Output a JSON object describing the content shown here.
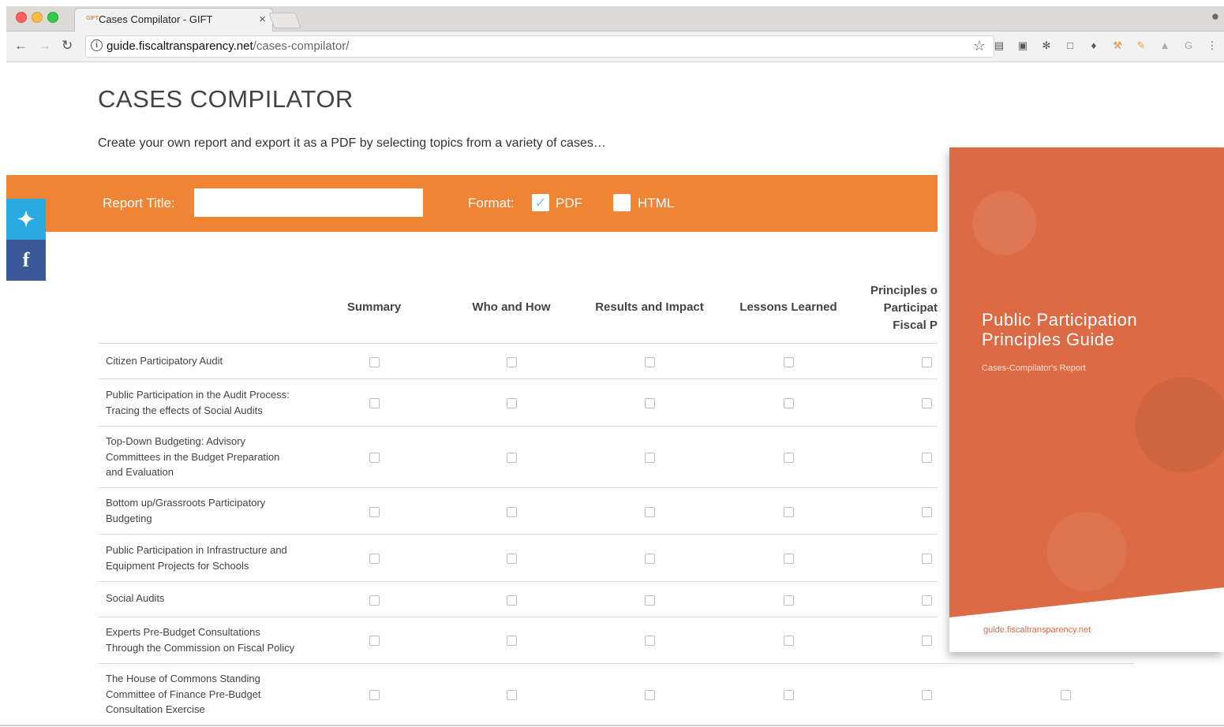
{
  "browser": {
    "tab_title": "Cases Compilator - GIFT",
    "tab_favicon": "GIFT",
    "tab_close": "×",
    "url_domain": "guide.fiscaltransparency.net",
    "url_path": "/cases-compilator/"
  },
  "page": {
    "title": "CASES COMPILATOR",
    "subtitle": "Create your own report and export it as a PDF by selecting topics from a variety of cases…"
  },
  "form": {
    "report_title_label": "Report Title:",
    "report_title_value": "",
    "format_label": "Format:",
    "formats": [
      {
        "label": "PDF",
        "checked": true
      },
      {
        "label": "HTML",
        "checked": false
      }
    ]
  },
  "social": {
    "twitter": "twitter-icon",
    "facebook": "facebook-icon"
  },
  "table": {
    "columns": [
      "Summary",
      "Who and How",
      "Results and Impact",
      "Lessons Learned",
      "Principles o\nParticipat\nFiscal P"
    ],
    "rows": [
      "Citizen Participatory Audit",
      "Public Participation in the Audit Process: Tracing the effects of Social Audits",
      "Top-Down Budgeting: Advisory Committees in the Budget Preparation and Evaluation",
      "Bottom up/Grassroots Participatory Budgeting",
      "Public Participation in Infrastructure and Equipment Projects for Schools",
      "Social Audits",
      "Experts Pre-Budget Consultations Through the Commission on Fiscal Policy",
      "The House of Commons Standing Committee of Finance Pre-Budget Consultation Exercise"
    ]
  },
  "cover": {
    "title_line1": "Public Participation",
    "title_line2": "Principles Guide",
    "subtitle": "Cases-Compilator's Report",
    "url": "guide.fiscaltransparency.net",
    "color": "#dc6a45"
  },
  "colors": {
    "accent": "#ef8534",
    "twitter": "#2ba9e1",
    "facebook": "#3b5998"
  }
}
